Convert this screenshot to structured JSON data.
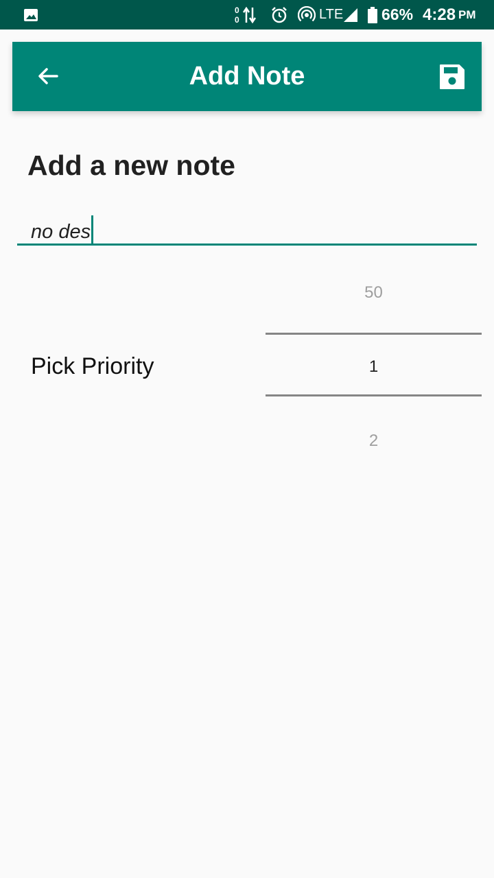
{
  "status_bar": {
    "data_in": "0",
    "data_out": "0",
    "network": "LTE",
    "battery_percent": "66%",
    "time": "4:28",
    "ampm": "PM",
    "icons": [
      "gallery-icon",
      "data-transfer-icon",
      "alarm-icon",
      "hotspot-icon",
      "signal-icon",
      "battery-icon"
    ]
  },
  "app_bar": {
    "title": "Add Note",
    "back_icon": "arrow-back-icon",
    "save_icon": "save-icon",
    "color": "#008577"
  },
  "form": {
    "heading": "Add a new note",
    "description_value": "no des",
    "priority_label": "Pick Priority",
    "priority_picker": {
      "previous": "50",
      "selected": "1",
      "next": "2"
    }
  },
  "colors": {
    "status_bar": "#00574b",
    "accent": "#008577",
    "background": "#fafafa"
  }
}
